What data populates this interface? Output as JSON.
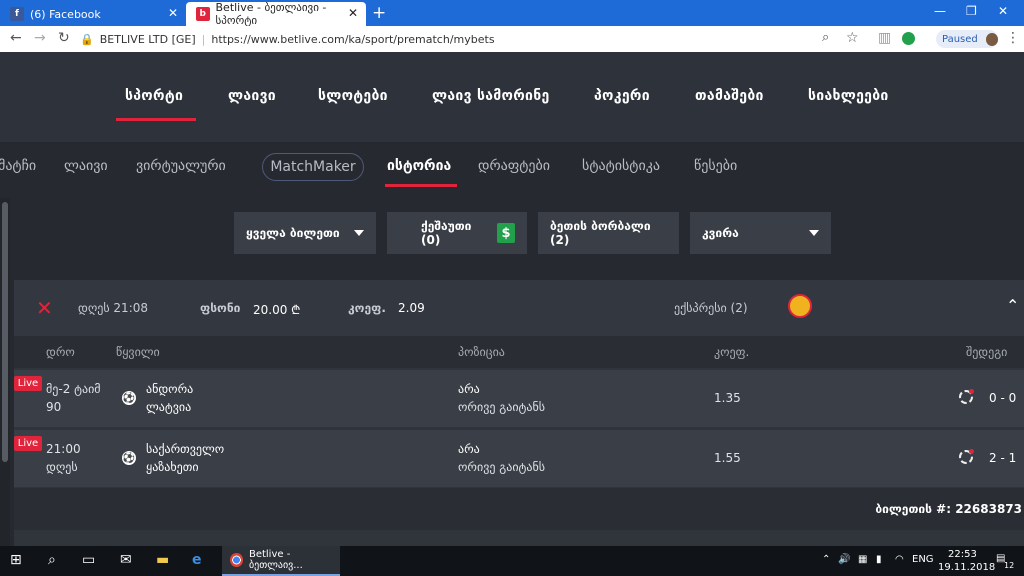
{
  "browser": {
    "tabs": [
      {
        "label": "(6) Facebook",
        "icon": "facebook-icon",
        "active": false
      },
      {
        "label": "Betlive - ბეთლაივი - სპორტი",
        "icon": "betlive-icon",
        "active": true
      }
    ],
    "url_site": "BETLIVE LTD [GE]",
    "url": "https://www.betlive.com/ka/sport/prematch/mybets",
    "paused_label": "Paused"
  },
  "main_nav": [
    "სპორტი",
    "ლაივი",
    "სლოტები",
    "ლაივ სამორინე",
    "პოკერი",
    "თამაშები",
    "სიახლეები"
  ],
  "sub_nav": [
    "მატჩი",
    "ლაივი",
    "ვირტუალური",
    "MatchMaker",
    "ისტორია",
    "დრაფტები",
    "სტატისტიკა",
    "წესები"
  ],
  "filters": {
    "all_tickets": "ყველა ბილეთი",
    "cashout": "ქეშაუთი (0)",
    "bet_builder": "ბეთის ბორბალი (2)",
    "period": "კვირა"
  },
  "bet": {
    "date": "დღეს 21:08",
    "stake_label": "ფსონი",
    "stake": "20.00 ₾",
    "coef_label": "კოეფ.",
    "coef": "2.09",
    "type": "ექსპრესი (2)"
  },
  "columns": {
    "time": "დრო",
    "event": "წყვილი",
    "position": "პოზიცია",
    "coef": "კოეფ.",
    "result": "შედეგი"
  },
  "rows": [
    {
      "badge": "Live",
      "time1": "მე-2 ტაიმ",
      "time2": "90",
      "team1": "ანდორა",
      "team2": "ლატვია",
      "pick": "არა",
      "market": "ორივე გაიტანს",
      "coef": "1.35",
      "score": "0 - 0"
    },
    {
      "badge": "Live",
      "time1": "21:00",
      "time2": "დღეს",
      "team1": "საქართველო",
      "team2": "ყაზახეთი",
      "pick": "არა",
      "market": "ორივე გაიტანს",
      "coef": "1.55",
      "score": "2 - 1"
    }
  ],
  "ticket": "ბილეთის #: 22683873",
  "taskbar": {
    "chrome_label": "Betlive - ბეთლაივ...",
    "lang": "ENG",
    "time": "22:53",
    "date": "19.11.2018",
    "notif_count": "12"
  },
  "colors": {
    "accent": "#e0243c",
    "header": "#2e323a",
    "background": "#262a30"
  }
}
